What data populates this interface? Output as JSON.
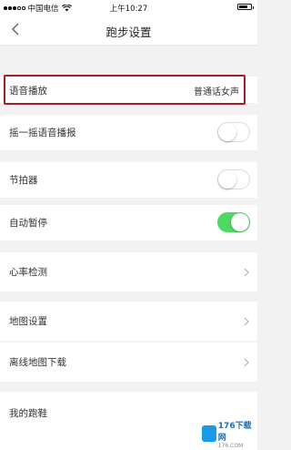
{
  "status_bar": {
    "carrier": "中国电信",
    "time": "上午10:27",
    "battery_level": 0.75
  },
  "nav": {
    "title": "跑步设置"
  },
  "settings": {
    "voice_broadcast": {
      "label": "语音播放",
      "value": "普通话女声"
    },
    "shake_voice": {
      "label": "摇一摇语音播报",
      "enabled": false
    },
    "metronome": {
      "label": "节拍器",
      "enabled": false
    },
    "auto_pause": {
      "label": "自动暂停",
      "enabled": true
    },
    "heart_rate": {
      "label": "心率检测"
    },
    "map_settings": {
      "label": "地图设置"
    },
    "offline_map": {
      "label": "离线地图下载"
    },
    "my_shoes": {
      "label": "我的跑鞋"
    }
  },
  "watermark": {
    "text": "176下载网",
    "sub": "176.COM"
  },
  "colors": {
    "toggle_on": "#4cd964",
    "highlight_border": "#a31d24"
  }
}
